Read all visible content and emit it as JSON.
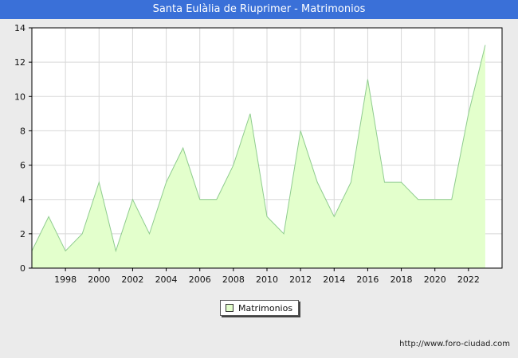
{
  "header": {
    "title": "Santa Eulàlia de Riuprimer - Matrimonios"
  },
  "chart_data": {
    "type": "area",
    "title": "Santa Eulàlia de Riuprimer - Matrimonios",
    "xlabel": "",
    "ylabel": "",
    "x": [
      1996,
      1997,
      1998,
      1999,
      2000,
      2001,
      2002,
      2003,
      2004,
      2005,
      2006,
      2007,
      2008,
      2009,
      2010,
      2011,
      2012,
      2013,
      2014,
      2015,
      2016,
      2017,
      2018,
      2019,
      2020,
      2021,
      2022,
      2023
    ],
    "series": [
      {
        "name": "Matrimonios",
        "values": [
          1,
          3,
          1,
          2,
          5,
          1,
          4,
          2,
          5,
          7,
          4,
          4,
          6,
          9,
          3,
          2,
          8,
          5,
          3,
          5,
          11,
          5,
          5,
          4,
          4,
          4,
          9,
          13
        ]
      }
    ],
    "xlim": [
      1996,
      2024
    ],
    "ylim": [
      0,
      14
    ],
    "x_ticks": [
      "1998",
      "2000",
      "2002",
      "2004",
      "2006",
      "2008",
      "2010",
      "2012",
      "2014",
      "2016",
      "2018",
      "2020",
      "2022"
    ],
    "y_ticks": [
      "0",
      "2",
      "4",
      "6",
      "8",
      "10",
      "12",
      "14"
    ],
    "grid": true,
    "legend_position": "bottom-center",
    "colors": {
      "fill": "#e3ffcc",
      "line": "#8fcc8f",
      "grid": "#d8d8d8",
      "plot_background": "#ffffff"
    }
  },
  "legend": {
    "label": "Matrimonios"
  },
  "footer": {
    "source": "http://www.foro-ciudad.com"
  }
}
